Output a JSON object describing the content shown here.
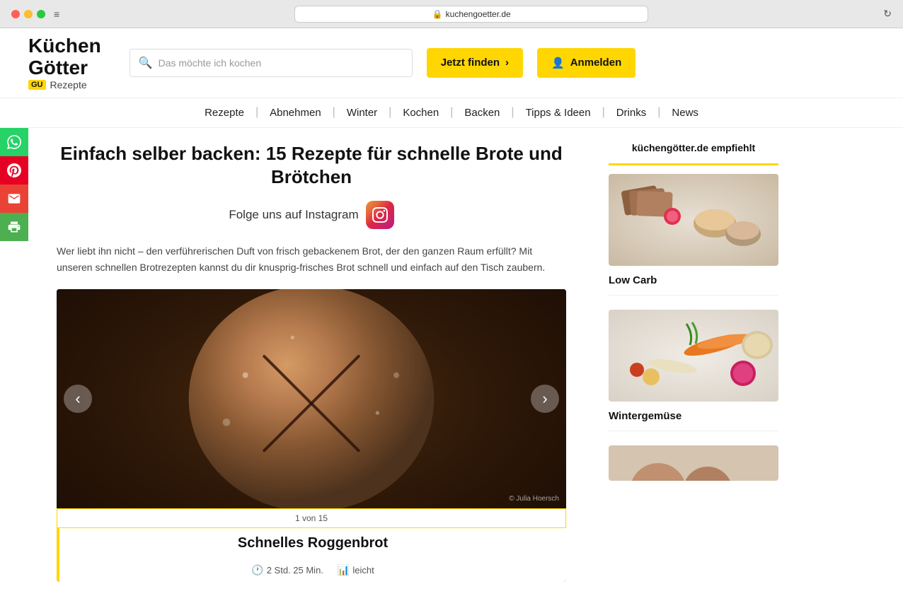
{
  "browser": {
    "url": "kuchengoetter.de",
    "lock_icon": "🔒",
    "reload_icon": "↻",
    "menu_icon": "≡"
  },
  "header": {
    "logo_line1": "Küchen",
    "logo_line2": "Götter",
    "gu_badge": "GU",
    "tagline": "Rezepte",
    "search_placeholder": "Das möchte ich kochen",
    "find_button": "Jetzt finden",
    "find_arrow": "›",
    "login_button": "Anmelden"
  },
  "nav": {
    "items": [
      {
        "label": "Rezepte",
        "separator": true
      },
      {
        "label": "Abnehmen",
        "separator": true
      },
      {
        "label": "Winter",
        "separator": true
      },
      {
        "label": "Kochen",
        "separator": true
      },
      {
        "label": "Backen",
        "separator": true
      },
      {
        "label": "Tipps & Ideen",
        "separator": true
      },
      {
        "label": "Drinks",
        "separator": true
      },
      {
        "label": "News",
        "separator": false
      }
    ]
  },
  "social": {
    "buttons": [
      {
        "name": "whatsapp",
        "icon": "✆"
      },
      {
        "name": "pinterest",
        "icon": "P"
      },
      {
        "name": "email",
        "icon": "✉"
      },
      {
        "name": "print",
        "icon": "⎙"
      }
    ]
  },
  "article": {
    "title": "Einfach selber backen: 15 Rezepte für schnelle Brote und Brötchen",
    "instagram_text": "Folge uns auf Instagram",
    "intro": "Wer liebt ihn nicht – den verführerischen Duft von frisch gebackenem Brot, der den ganzen Raum erfüllt? Mit unseren schnellen Brotrezepten kannst du dir knusprig-frisches Brot schnell und einfach auf den Tisch zaubern.",
    "photo_credit": "© Julia Hoersch",
    "slide_counter": "1 von 15",
    "slide_title": "Schnelles Roggenbrot",
    "slide_time": "2 Std. 25 Min.",
    "slide_difficulty": "leicht",
    "prev_arrow": "‹",
    "next_arrow": "›"
  },
  "sidebar": {
    "heading": "küchengötter.de empfiehlt",
    "cards": [
      {
        "title": "Low Carb"
      },
      {
        "title": "Wintergemüse"
      },
      {
        "title": ""
      }
    ]
  }
}
